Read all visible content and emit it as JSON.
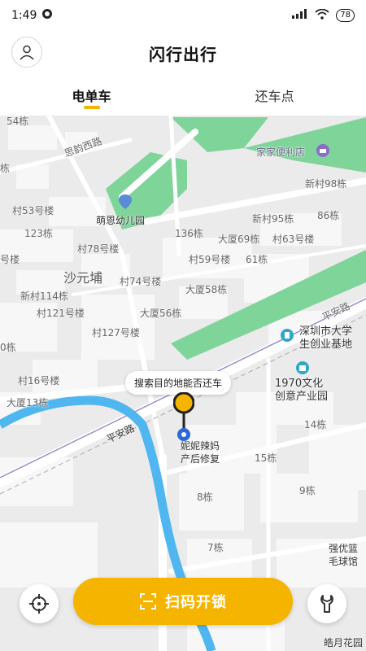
{
  "status": {
    "time": "1:49",
    "battery": "78"
  },
  "header": {
    "title": "闪行出行"
  },
  "tabs": [
    {
      "label": "电单车"
    },
    {
      "label": "还车点"
    }
  ],
  "map": {
    "labels": {
      "l54": "54栋",
      "siyun": "思韵西路",
      "shi": "栋",
      "jiajia": "家家便利店",
      "xc98": "新村98栋",
      "cun53": "村53号楼",
      "mengen": "萌恩幼儿园",
      "d123": "123栋",
      "d136": "136栋",
      "xc95": "新村95栋",
      "d86": "86栋",
      "cun78": "村78号楼",
      "ds69": "大厦69栋",
      "cun63": "村63号楼",
      "hao": "号楼",
      "cun59": "村59号楼",
      "d61": "61栋",
      "shayuan": "沙元埔",
      "cun74": "村74号楼",
      "ds58": "大厦58栋",
      "xc114": "新村114栋",
      "cun121": "村121号楼",
      "ds56": "大厦56栋",
      "pingan1": "平安路",
      "cun127": "村127号楼",
      "shiyi": "0栋",
      "cun16": "村16号楼",
      "ds13": "大厦13栋",
      "wenhua1970": "1970文化\n创意产业园",
      "d14": "14栋",
      "pingan2": "平安路",
      "d15": "15栋",
      "d8": "8栋",
      "d9": "9栋",
      "d7": "7栋",
      "shenzhen": "深圳市大学\n生创业基地",
      "nini": "妮妮辣妈\n产后修复",
      "qiangyou": "强优篮\n毛球馆",
      "haoyue": "皓月花园"
    },
    "tooltip": "搜索目的地能否还车"
  },
  "actions": {
    "scan_label": "扫码开锁"
  },
  "colors": {
    "accent": "#f5b400",
    "park": "#7fd49a",
    "river": "#4fb6f0",
    "road": "#ffffff"
  }
}
